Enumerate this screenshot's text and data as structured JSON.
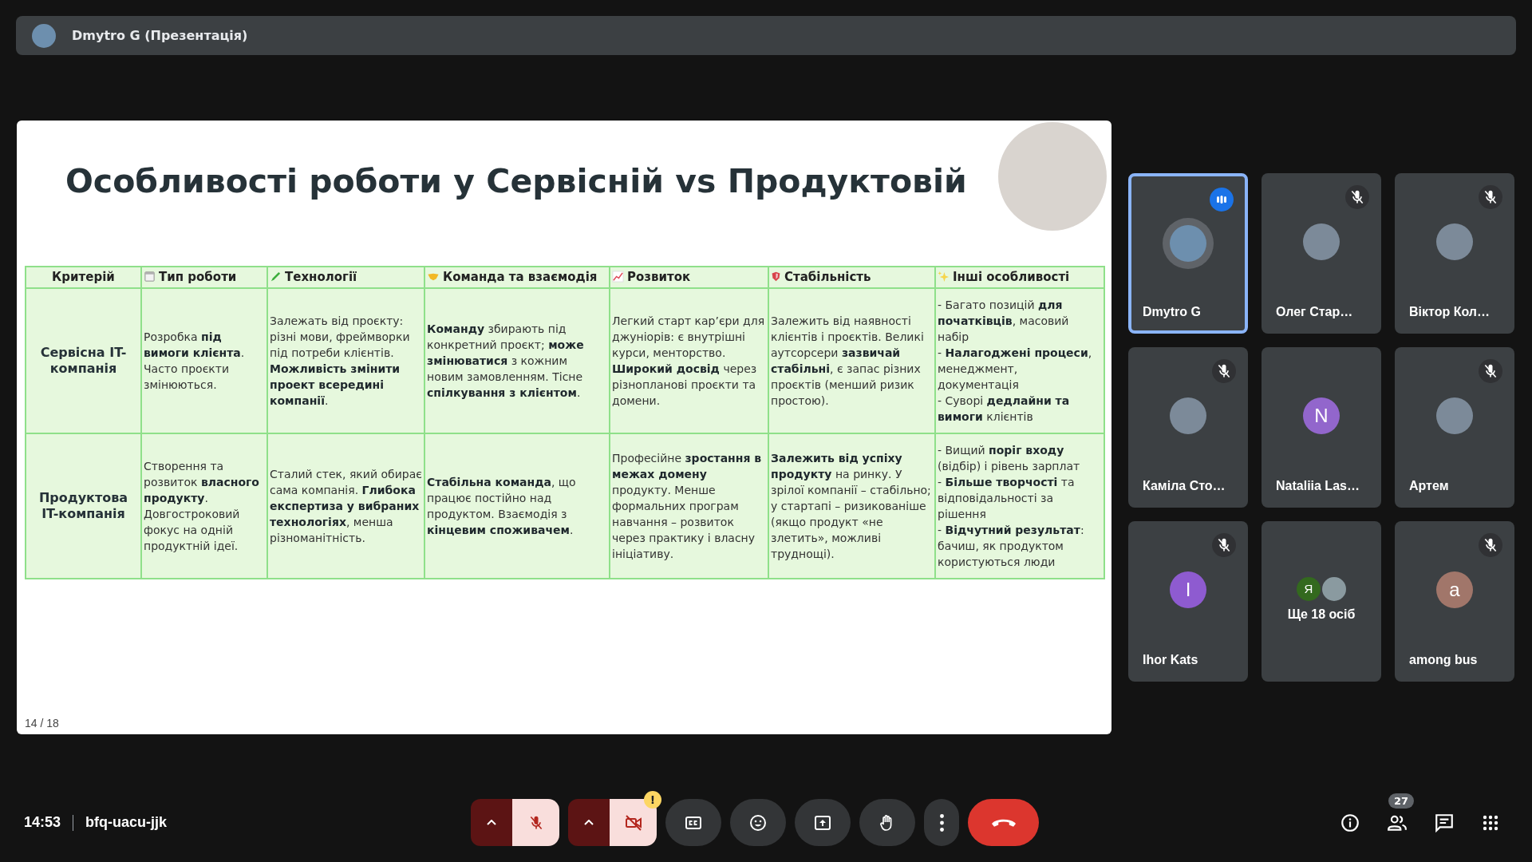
{
  "top_bar": {
    "presenter": "Dmytro G (Презентація)"
  },
  "slide": {
    "title": "Особливості роботи у Сервісній vs Продуктовій",
    "page": "14 / 18",
    "table": {
      "columns": [
        {
          "label": "Критерій"
        },
        {
          "label": "Тип роботи"
        },
        {
          "label": "Технології"
        },
        {
          "label": "Команда та взаємодія"
        },
        {
          "label": "Розвиток"
        },
        {
          "label": "Стабільність"
        },
        {
          "label": "Інші особливості"
        }
      ],
      "rows": [
        {
          "cells": [
            "Сервісна IT-компанія",
            "Розробка **під вимоги клієнта**. Часто проєкти змінюються.",
            "Залежать від проєкту: різні мови, фреймворки під потреби клієнтів. **Можливість змінити проект всередині компанії**.",
            "**Команду** збирають під конкретний проєкт; **може змінюватися** з кожним новим замовленням. Тісне **спілкування з клієнтом**.",
            "Легкий старт кар’єри для джуніорів: є внутрішні курси, менторство. **Широкий досвід** через різнопланові проєкти та домени.",
            "Залежить від наявності клієнтів і проєктів. Великі аутсорсери **зазвичай стабільні**, є запас різних проєктів (менший ризик простою).",
            [
              "- Багато позицій **для початківців**, масовий набір",
              "- **Налагоджені процеси**, менеджмент, документація",
              "- Суворі **дедлайни та вимоги** клієнтів"
            ]
          ]
        },
        {
          "cells": [
            "Продуктова IT-компанія",
            "Створення та розвиток **власного продукту**. Довгостроковий фокус на одній продуктній ідеї.",
            "Сталий стек, який обирає сама компанія. **Глибока експертиза у вибраних технологіях**, менша різноманітність.",
            "**Стабільна команда**, що працює постійно над продуктом. Взаємодія з **кінцевим споживачем**.",
            "Професійне **зростання в межах домену** продукту. Менше формальних програм навчання – розвиток через практику і власну ініціативу.",
            "**Залежить від успіху продукту** на ринку. У зрілої компанії – стабільно; у стартапі – ризикованіше (якщо продукт «не злетить», можливі труднощі).",
            [
              "- Вищий **поріг входу** (відбір) і рівень зарплат",
              "- **Більше творчості** та відповідальності за рішення",
              "- **Відчутний результат**: бачиш, як продуктом користуються люди"
            ]
          ]
        }
      ]
    }
  },
  "participants": [
    {
      "kind": "person",
      "name": "Dmytro G",
      "speaking": true,
      "muted": false,
      "avatar": {
        "kind": "photo"
      }
    },
    {
      "kind": "person",
      "name": "Олег Стар…",
      "speaking": false,
      "muted": true,
      "avatar": {
        "kind": "photo"
      }
    },
    {
      "kind": "person",
      "name": "Віктор Кол…",
      "speaking": false,
      "muted": true,
      "avatar": {
        "kind": "photo"
      }
    },
    {
      "kind": "person",
      "name": "Каміла Сто…",
      "speaking": false,
      "muted": true,
      "avatar": {
        "kind": "photo"
      }
    },
    {
      "kind": "person",
      "name": "Nataliia Las…",
      "speaking": false,
      "muted": false,
      "avatar": {
        "kind": "letter",
        "letter": "N",
        "color": "#9266cc"
      }
    },
    {
      "kind": "person",
      "name": "Артем",
      "speaking": false,
      "muted": true,
      "avatar": {
        "kind": "photo"
      }
    },
    {
      "kind": "person",
      "name": "Ihor Kats",
      "speaking": false,
      "muted": true,
      "avatar": {
        "kind": "letter",
        "letter": "I",
        "color": "#8e5bd0"
      }
    },
    {
      "kind": "more",
      "label": "Ще 18 осіб",
      "avatars": [
        {
          "kind": "letter",
          "letter": "Я",
          "color": "#33691e"
        },
        {
          "kind": "photo"
        }
      ]
    },
    {
      "kind": "person",
      "name": "among bus",
      "speaking": false,
      "muted": true,
      "avatar": {
        "kind": "letter",
        "letter": "a",
        "color": "#a1766a"
      }
    }
  ],
  "bottom_bar": {
    "time": "14:53",
    "meeting_code": "bfq-uacu-jjk",
    "controls": [
      {
        "kind": "mic",
        "on": false
      },
      {
        "kind": "camera",
        "on": false,
        "warning": "!"
      },
      {
        "kind": "captions"
      },
      {
        "kind": "emoji"
      },
      {
        "kind": "present"
      },
      {
        "kind": "hand"
      },
      {
        "kind": "more"
      },
      {
        "kind": "end_call"
      }
    ],
    "side_buttons": [
      {
        "kind": "info"
      },
      {
        "kind": "people",
        "badge": "27"
      },
      {
        "kind": "chat"
      },
      {
        "kind": "apps"
      }
    ]
  }
}
